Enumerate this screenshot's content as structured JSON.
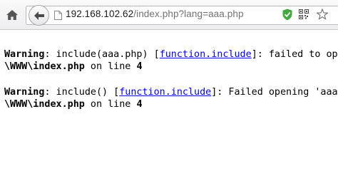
{
  "browser": {
    "url_host": "192.168.102.62",
    "url_path": "/index.php?lang=aaa.php"
  },
  "icons": {
    "home": "home-icon",
    "back": "back-arrow-icon",
    "page": "page-icon",
    "shield": "shield-check-icon",
    "qr": "qr-code-icon",
    "bookmark": "star-icon"
  },
  "colors": {
    "link": "#0000ee",
    "shield": "#4caf50"
  },
  "warnings": [
    {
      "label": "Warning",
      "pre": ": include(aaa.php) [",
      "link": "function.include",
      "post": "]: failed to op",
      "file": "\\WWW\\index.php",
      "on_line": " on line ",
      "line": "4"
    },
    {
      "label": "Warning",
      "pre": ": include() [",
      "link": "function.include",
      "post": "]: Failed opening 'aaa",
      "file": "\\WWW\\index.php",
      "on_line": " on line ",
      "line": "4"
    }
  ]
}
